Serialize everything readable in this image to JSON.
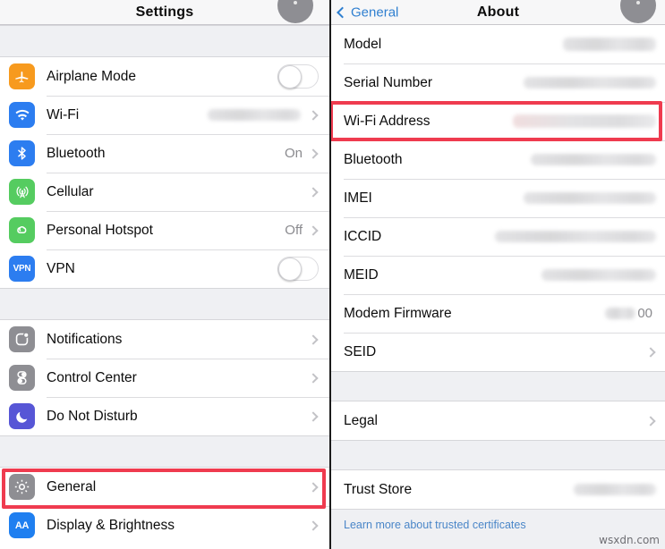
{
  "left_panel": {
    "nav": {
      "title": "Settings",
      "badge_icon": "gray-circle-badge"
    },
    "groups": [
      {
        "rows": [
          {
            "label": "Airplane Mode",
            "icon": "airplane-icon",
            "control": "toggle",
            "value": ""
          },
          {
            "label": "Wi-Fi",
            "icon": "wifi-icon",
            "control": "chevron",
            "value": "",
            "redacted": true
          },
          {
            "label": "Bluetooth",
            "icon": "bluetooth-icon",
            "control": "chevron",
            "value": "On"
          },
          {
            "label": "Cellular",
            "icon": "cellular-icon",
            "control": "chevron",
            "value": ""
          },
          {
            "label": "Personal Hotspot",
            "icon": "hotspot-icon",
            "control": "chevron",
            "value": "Off"
          },
          {
            "label": "VPN",
            "icon": "vpn-icon",
            "control": "toggle",
            "value": ""
          }
        ]
      },
      {
        "rows": [
          {
            "label": "Notifications",
            "icon": "notifications-icon",
            "control": "chevron",
            "value": ""
          },
          {
            "label": "Control Center",
            "icon": "control-center-icon",
            "control": "chevron",
            "value": ""
          },
          {
            "label": "Do Not Disturb",
            "icon": "moon-icon",
            "control": "chevron",
            "value": ""
          }
        ]
      },
      {
        "rows": [
          {
            "label": "General",
            "icon": "gear-icon",
            "control": "chevron",
            "value": "",
            "highlighted": true
          },
          {
            "label": "Display & Brightness",
            "icon": "display-brightness-icon",
            "control": "chevron",
            "value": ""
          }
        ]
      }
    ]
  },
  "right_panel": {
    "nav": {
      "back_label": "General",
      "title": "About",
      "badge_icon": "gray-circle-badge"
    },
    "groups": [
      {
        "rows": [
          {
            "label": "Model",
            "value": "",
            "redacted": true,
            "redact_width": 104
          },
          {
            "label": "Serial Number",
            "value": "",
            "redacted": true,
            "redact_width": 148
          },
          {
            "label": "Wi-Fi Address",
            "value": "",
            "redacted": true,
            "redact_width": 160,
            "highlighted": true
          },
          {
            "label": "Bluetooth",
            "value": "",
            "redacted": true,
            "redact_width": 140
          },
          {
            "label": "IMEI",
            "value": "",
            "redacted": true,
            "redact_width": 148
          },
          {
            "label": "ICCID",
            "value": "",
            "redacted": true,
            "redact_width": 180
          },
          {
            "label": "MEID",
            "value": "",
            "redacted": true,
            "redact_width": 128
          },
          {
            "label": "Modem Firmware",
            "value": "00",
            "redacted": true,
            "redact_width": 34
          },
          {
            "label": "SEID",
            "value": "",
            "control": "chevron"
          }
        ]
      },
      {
        "rows": [
          {
            "label": "Legal",
            "value": "",
            "control": "chevron"
          }
        ]
      },
      {
        "rows": [
          {
            "label": "Trust Store",
            "value": "",
            "redacted": true,
            "redact_width": 92
          }
        ]
      }
    ],
    "footer_link": "Learn more about trusted certificates"
  },
  "watermark": "wsxdn.com",
  "colors": {
    "accent_blue": "#2f7fd0",
    "highlight_red": "#ef3b4f",
    "group_gap": "#eff0f3",
    "row_value_gray": "#8a8a8e"
  }
}
